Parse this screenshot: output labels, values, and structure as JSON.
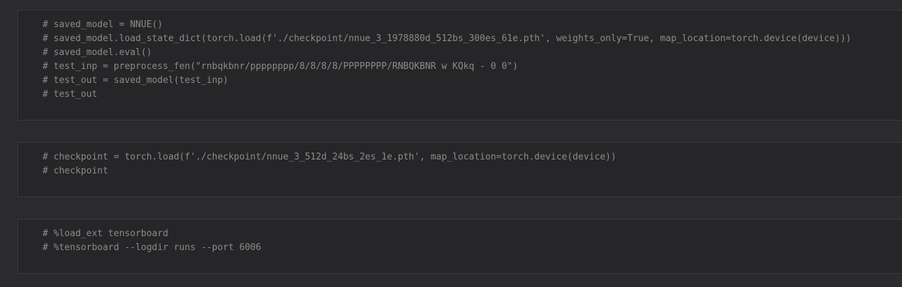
{
  "cells": [
    {
      "lines": [
        "# saved_model = NNUE()",
        "# saved_model.load_state_dict(torch.load(f'./checkpoint/nnue_3_1978880d_512bs_300es_61e.pth', weights_only=True, map_location=torch.device(device)))",
        "# saved_model.eval()",
        "# test_inp = preprocess_fen(\"rnbqkbnr/pppppppp/8/8/8/8/PPPPPPPP/RNBQKBNR w KQkq - 0 0\")",
        "# test_out = saved_model(test_inp)",
        "# test_out"
      ]
    },
    {
      "lines": [
        "# checkpoint = torch.load(f'./checkpoint/nnue_3_512d_24bs_2es_1e.pth', map_location=torch.device(device))",
        "# checkpoint"
      ]
    },
    {
      "lines": [
        "# %load_ext tensorboard",
        "# %tensorboard --logdir runs --port 6006"
      ]
    }
  ]
}
